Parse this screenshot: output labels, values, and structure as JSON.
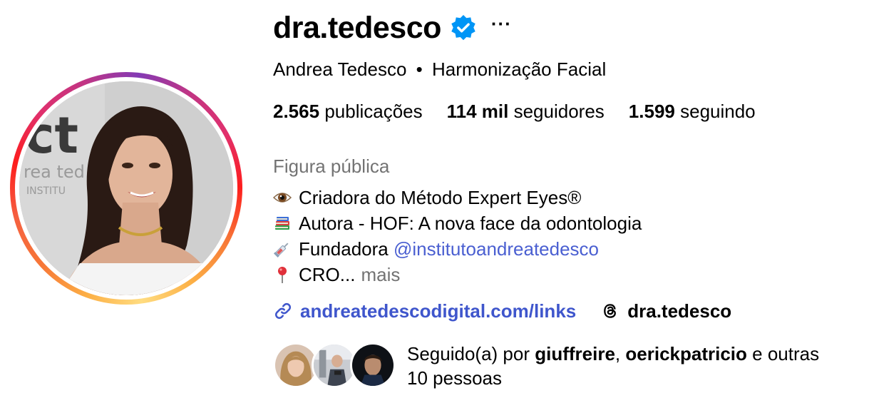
{
  "profile": {
    "username": "dra.tedesco",
    "more_label": "···",
    "full_name": "Andrea Tedesco",
    "separator": "•",
    "subtitle": "Harmonização Facial",
    "verified": true,
    "accent_color": "#0095f6"
  },
  "stats": {
    "posts_count": "2.565",
    "posts_label": "publicações",
    "followers_count": "114 mil",
    "followers_label": "seguidores",
    "following_count": "1.599",
    "following_label": "seguindo"
  },
  "category": "Figura pública",
  "bio": {
    "lines": [
      {
        "icon": "eye-icon",
        "text": "Criadora do Método Expert Eyes®"
      },
      {
        "icon": "books-icon",
        "text": "Autora - HOF: A nova face da odontologia"
      },
      {
        "icon": "syringe-icon",
        "text": "Fundadora ",
        "mention": "@institutoandreatedesco"
      },
      {
        "icon": "pin-icon",
        "text": "CRO...",
        "more": "mais"
      }
    ]
  },
  "links": {
    "website": "andreatedescodigital.com/links",
    "threads_handle": "dra.tedesco"
  },
  "followed_by": {
    "prefix": "Seguido(a) por",
    "user1": "giuffreire",
    "comma": ",",
    "user2": "oerickpatricio",
    "and_others": "e outras",
    "count_text": "10 pessoas"
  }
}
